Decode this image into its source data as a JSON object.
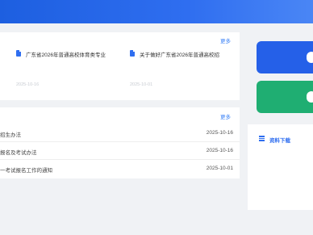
{
  "colors": {
    "banner": "#2f6ef0",
    "accent": "#3b82f6",
    "button_primary": "#2560e8",
    "button_success": "#1fae72",
    "background": "#f0f2f5"
  },
  "news": {
    "more_label": "更多",
    "items": [
      {
        "title": "广东省2026年普通高校体育类专业",
        "date": "2025-10-16",
        "icon": "document-icon"
      },
      {
        "title": "关于做好广东省2026年普通高校招",
        "date": "2025-10-01",
        "icon": "document-icon"
      }
    ]
  },
  "list": {
    "more_label": "更多",
    "rows": [
      {
        "title": "招生办法",
        "date": "2025-10-16"
      },
      {
        "title": "报名及考试办法",
        "date": "2025-10-16"
      },
      {
        "title": "一考试报名工作的通知",
        "date": "2025-10-01"
      }
    ]
  },
  "downloads": {
    "title": "资料下载",
    "icon": "list-icon"
  }
}
